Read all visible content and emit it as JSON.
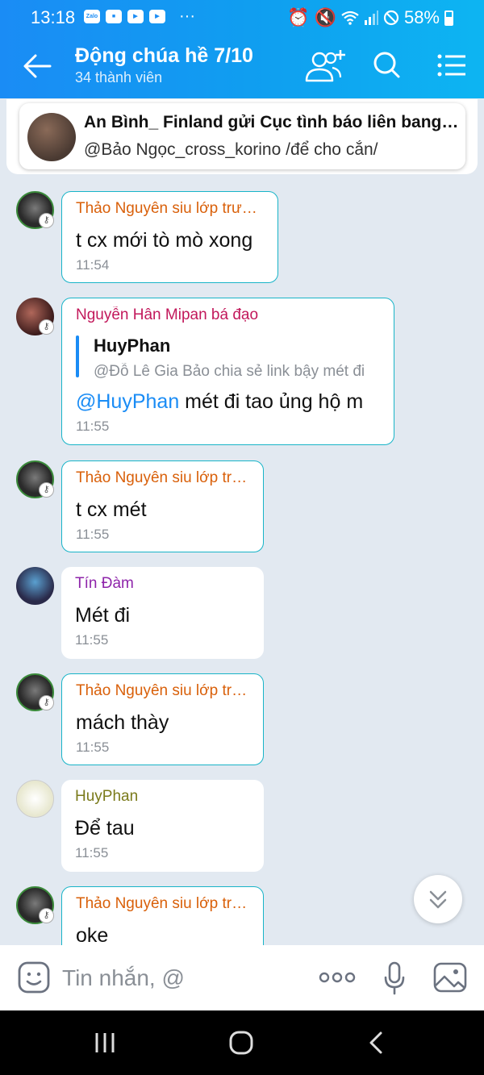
{
  "status_bar": {
    "time": "13:18",
    "battery": "58%",
    "app_icons": [
      "zalo-icon",
      "gamepad-icon",
      "youtube-icon",
      "youtube-icon"
    ],
    "system_icons": [
      "alarm-icon",
      "mute-icon",
      "wifi-icon",
      "signal-icon",
      "dnd-icon",
      "battery-icon"
    ]
  },
  "header": {
    "title": "Động chúa hề 7/10",
    "subtitle": "34 thành viên",
    "icons": [
      "back-arrow-icon",
      "add-member-icon",
      "search-icon",
      "menu-list-icon"
    ],
    "colors": {
      "gradient_start": "#1a8cf5",
      "gradient_end": "#0db5f2"
    }
  },
  "pinned": {
    "title": "An Bình_ Finland gửi Cục tình báo liên bang Mỹ",
    "text": "@Bảo Ngọc_cross_korino /để cho cắn/"
  },
  "messages": [
    {
      "sender": "Thảo Nguyên siu lớp trưởng",
      "sender_color": "#d9600a",
      "text": "t cx mới tò mò xong",
      "time": "11:54"
    },
    {
      "sender": "Nguyễn Hân Mipan bá đạo",
      "sender_color": "#c2185b",
      "quote_name": "HuyPhan",
      "quote_text": "@Đỗ Lê Gia Bảo chia sẻ link bậy mét đi",
      "mention": "@HuyPhan",
      "text": " mét đi tao ủng hộ m",
      "time": "11:55"
    },
    {
      "sender": "Thảo Nguyên siu lớp trưởng",
      "sender_color": "#d9600a",
      "text": "t cx mét",
      "time": "11:55"
    },
    {
      "sender": "Tín Đàm",
      "sender_color": "#8e24aa",
      "text": "Mét đi",
      "time": "11:55"
    },
    {
      "sender": "Thảo Nguyên siu lớp trưởng",
      "sender_color": "#d9600a",
      "text": "mách thày",
      "time": "11:55"
    },
    {
      "sender": "HuyPhan",
      "sender_color": "#7a7a1a",
      "text": "Để tau",
      "time": "11:55"
    },
    {
      "sender": "Thảo Nguyên siu lớp trưởng",
      "sender_color": "#d9600a",
      "text": "oke",
      "time": ""
    }
  ],
  "input": {
    "placeholder": "Tin nhắn, @"
  },
  "accent_color": "#18b4c8"
}
